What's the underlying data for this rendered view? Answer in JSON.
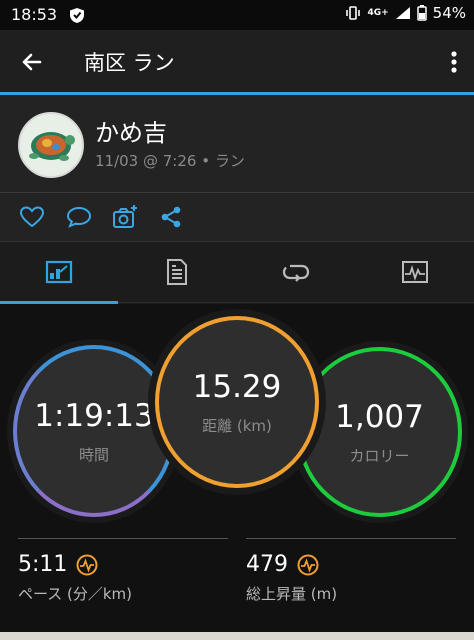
{
  "status": {
    "time": "18:53",
    "network": "4G+",
    "battery": "54%"
  },
  "appbar": {
    "title": "南区 ラン"
  },
  "activity": {
    "user": "かめ吉",
    "meta": "11/03 @ 7:26 • ラン"
  },
  "stats": {
    "time": {
      "value": "1:19:13",
      "label": "時間"
    },
    "distance": {
      "value": "15.29",
      "label": "距離 (km)"
    },
    "calories": {
      "value": "1,007",
      "label": "カロリー"
    },
    "pace": {
      "value": "5:11",
      "label": "ペース (分／km)"
    },
    "elevation": {
      "value": "479",
      "label": "総上昇量 (m)"
    }
  },
  "colors": {
    "accent": "#2fa4e0",
    "distance": "#f0a030",
    "calories": "#1ccc3c",
    "time": "#3d93d8",
    "insight": "#f0a030"
  }
}
